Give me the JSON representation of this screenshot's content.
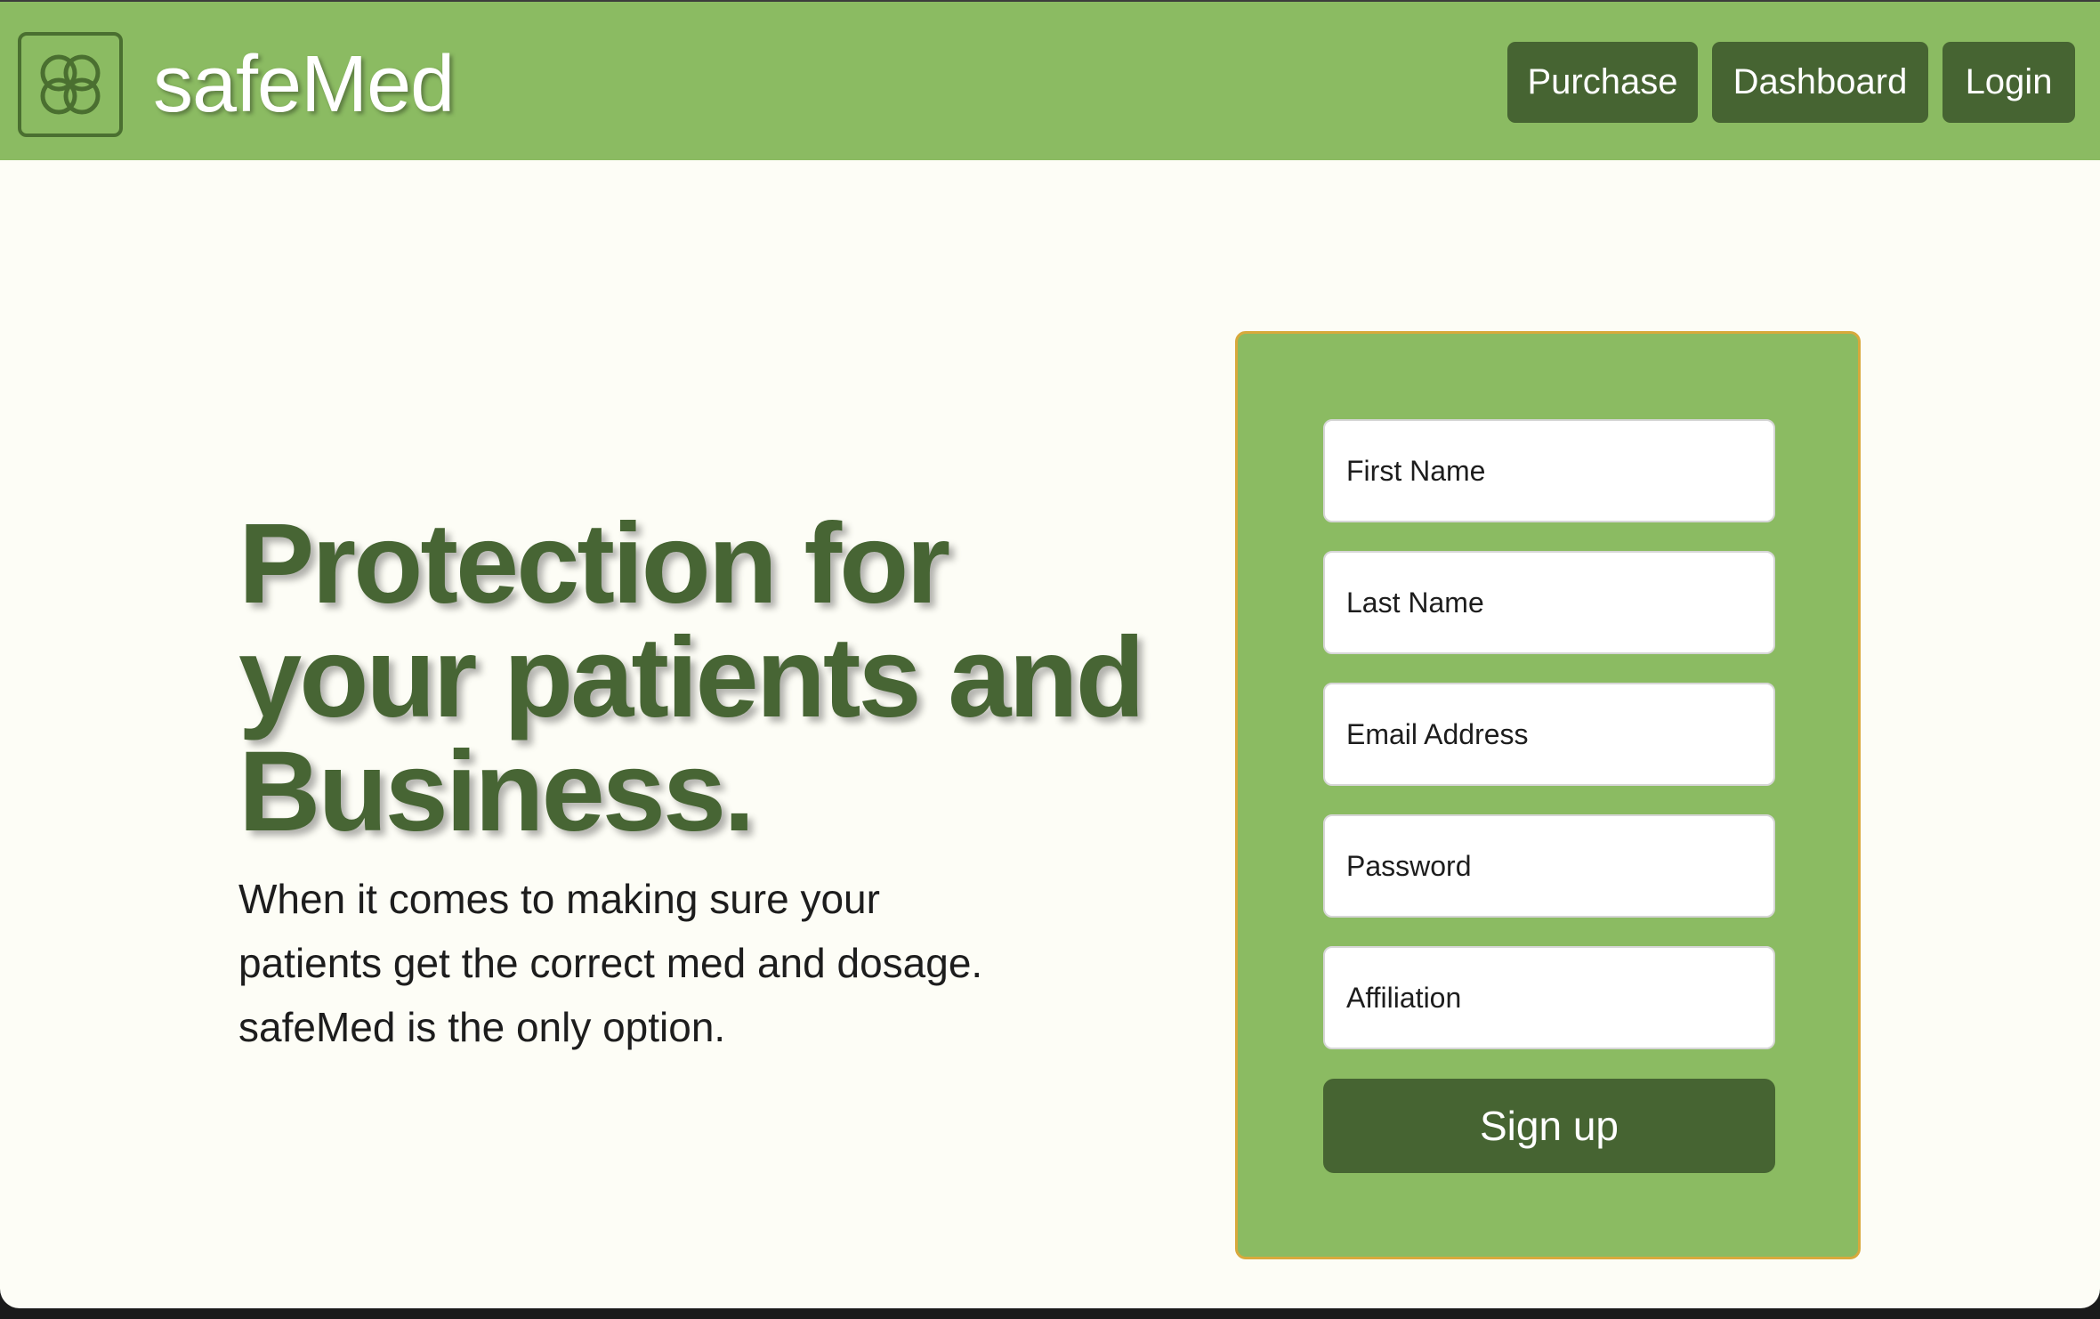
{
  "brand": {
    "name": "safeMed",
    "logo_icon": "four-circles-logo-icon"
  },
  "nav": {
    "purchase_label": "Purchase",
    "dashboard_label": "Dashboard",
    "login_label": "Login"
  },
  "hero": {
    "title_line1": "Protection for",
    "title_line2": "your patients and",
    "title_line3": "Business.",
    "text_line1": "When it comes to making sure your",
    "text_line2": "patients get the correct med and dosage.",
    "text_line3": "safeMed is the only option."
  },
  "signup": {
    "first_name_placeholder": "First Name",
    "last_name_placeholder": "Last Name",
    "email_placeholder": "Email Address",
    "password_placeholder": "Password",
    "affiliation_placeholder": "Affiliation",
    "submit_label": "Sign up"
  },
  "colors": {
    "nav_green": "#8bbb62",
    "dark_green": "#466432",
    "page_background": "#fdfdf6",
    "card_border": "#d8a93c"
  }
}
